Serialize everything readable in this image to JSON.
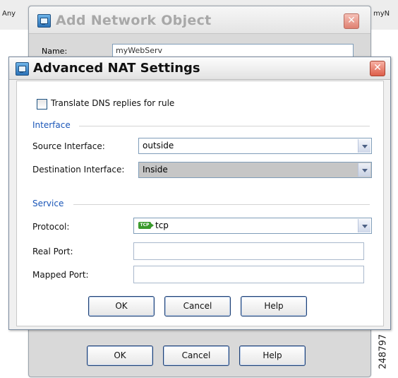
{
  "background": {
    "left_text": "Any",
    "right_text": "myN"
  },
  "back_dialog": {
    "title": "Add Network Object",
    "name_label": "Name:",
    "name_value": "myWebServ",
    "ok_label": "OK",
    "cancel_label": "Cancel",
    "help_label": "Help"
  },
  "front_dialog": {
    "title": "Advanced NAT Settings",
    "close_symbol": "✕",
    "translate_dns": {
      "label": "Translate DNS replies for rule",
      "checked": false
    },
    "interface_group": {
      "title": "Interface",
      "source_label": "Source Interface:",
      "source_value": "outside",
      "destination_label": "Destination Interface:",
      "destination_value": "Inside"
    },
    "service_group": {
      "title": "Service",
      "protocol_label": "Protocol:",
      "protocol_icon_text": "TCP",
      "protocol_value": "tcp",
      "real_port_label": "Real Port:",
      "real_port_value": "",
      "mapped_port_label": "Mapped Port:",
      "mapped_port_value": ""
    },
    "ok_label": "OK",
    "cancel_label": "Cancel",
    "help_label": "Help"
  },
  "figure_code": "248797",
  "colors": {
    "group_title": "#1a56b8",
    "close_button": "#dd5e4a",
    "disabled_field": "#c6c6c6",
    "tcp_icon": "#3a9a2c"
  }
}
